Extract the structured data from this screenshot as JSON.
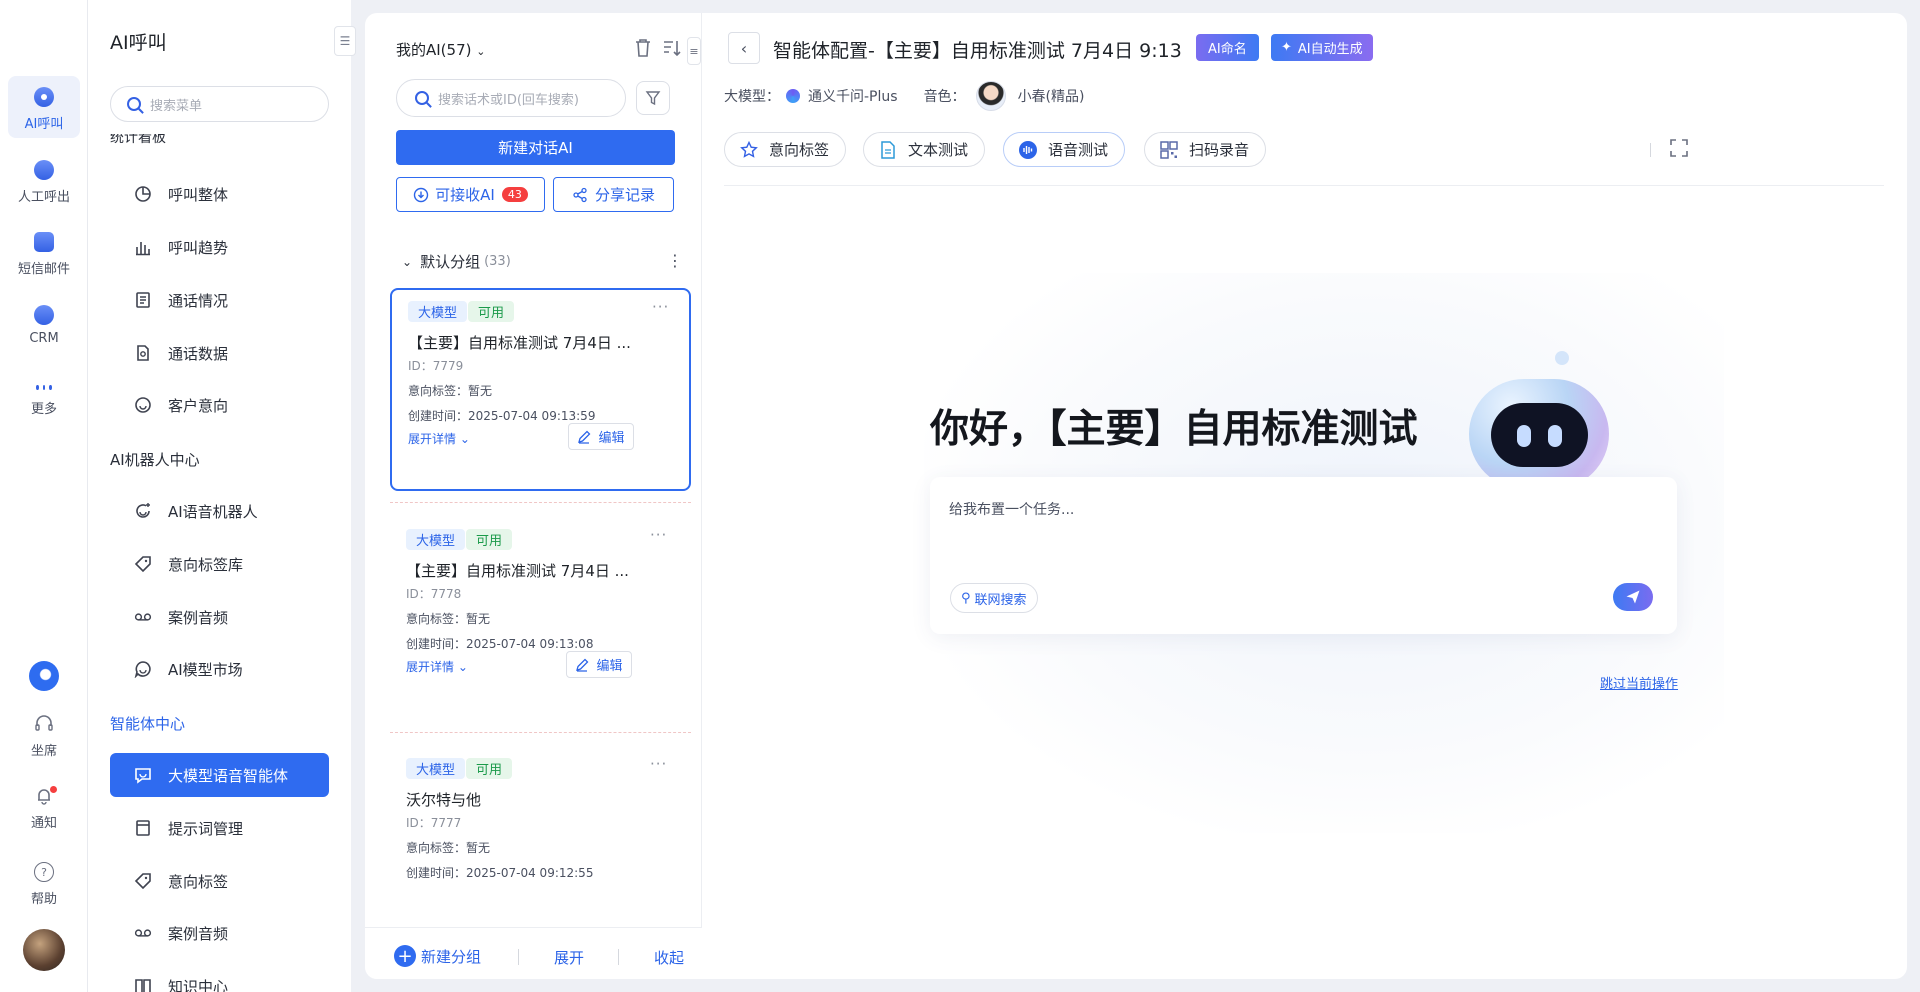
{
  "rail": {
    "items": [
      {
        "label": "AI呼叫",
        "icon": "ai-call-icon"
      },
      {
        "label": "人工呼出",
        "icon": "manual-call-icon"
      },
      {
        "label": "短信邮件",
        "icon": "sms-mail-icon"
      },
      {
        "label": "CRM",
        "icon": "crm-icon"
      },
      {
        "label": "更多",
        "icon": "more-icon"
      }
    ],
    "bottom": [
      {
        "label": "坐席",
        "icon": "headset-icon"
      },
      {
        "label": "通知",
        "icon": "bell-icon"
      },
      {
        "label": "帮助",
        "icon": "help-icon"
      }
    ]
  },
  "menu": {
    "title": "AI呼叫",
    "search_placeholder": "搜索菜单",
    "clipped_section": "统计看板",
    "stats_items": [
      "呼叫整体",
      "呼叫趋势",
      "通话情况",
      "通话数据",
      "客户意向"
    ],
    "robot_section": "AI机器人中心",
    "robot_items": [
      "AI语音机器人",
      "意向标签库",
      "案例音频",
      "AI模型市场"
    ],
    "agent_section": "智能体中心",
    "agent_items": [
      "大模型语音智能体",
      "提示词管理",
      "意向标签",
      "案例音频",
      "知识中心"
    ]
  },
  "list": {
    "my_ai": "我的AI(57)",
    "search_placeholder": "搜索话术或ID(回车搜索)",
    "new_button": "新建对话AI",
    "receive_button": "可接收AI",
    "receive_count": "43",
    "share_button": "分享记录",
    "group_name": "默认分组",
    "group_count": "(33)",
    "cards": [
      {
        "tag1": "大模型",
        "tag2": "可用",
        "title": "【主要】自用标准测试 7月4日 ...",
        "id": "ID：7779",
        "intent": "意向标签：暂无",
        "created": "创建时间：2025-07-04 09:13:59",
        "expand": "展开详情",
        "edit": "编辑"
      },
      {
        "tag1": "大模型",
        "tag2": "可用",
        "title": "【主要】自用标准测试 7月4日 ...",
        "id": "ID：7778",
        "intent": "意向标签：暂无",
        "created": "创建时间：2025-07-04 09:13:08",
        "expand": "展开详情",
        "edit": "编辑"
      },
      {
        "tag1": "大模型",
        "tag2": "可用",
        "title": "沃尔特与他",
        "id": "ID：7777",
        "intent": "意向标签：暂无",
        "created": "创建时间：2025-07-04 09:12:55"
      }
    ],
    "footer": {
      "add_group": "新建分组",
      "expand": "展开",
      "collapse": "收起"
    }
  },
  "config": {
    "title": "智能体配置-【主要】自用标准测试 7月4日 9:13",
    "ai_name_button": "AI命名",
    "ai_generate_button": "AI自动生成",
    "model_label": "大模型：",
    "model_value": "通义千问-Plus",
    "voice_label": "音色：",
    "voice_value": "小春(精品)",
    "actions": [
      "意向标签",
      "文本测试",
      "语音测试",
      "扫码录音"
    ],
    "greeting": "你好，【主要】自用标准测试",
    "input_placeholder": "给我布置一个任务...",
    "web_search": "联网搜索",
    "skip": "跳过当前操作"
  },
  "colors": {
    "accent": "#2f6bf0",
    "badge": "#f53f3f",
    "tag_blue_bg": "#e8f1fe",
    "tag_green_bg": "#e6f6ea"
  }
}
